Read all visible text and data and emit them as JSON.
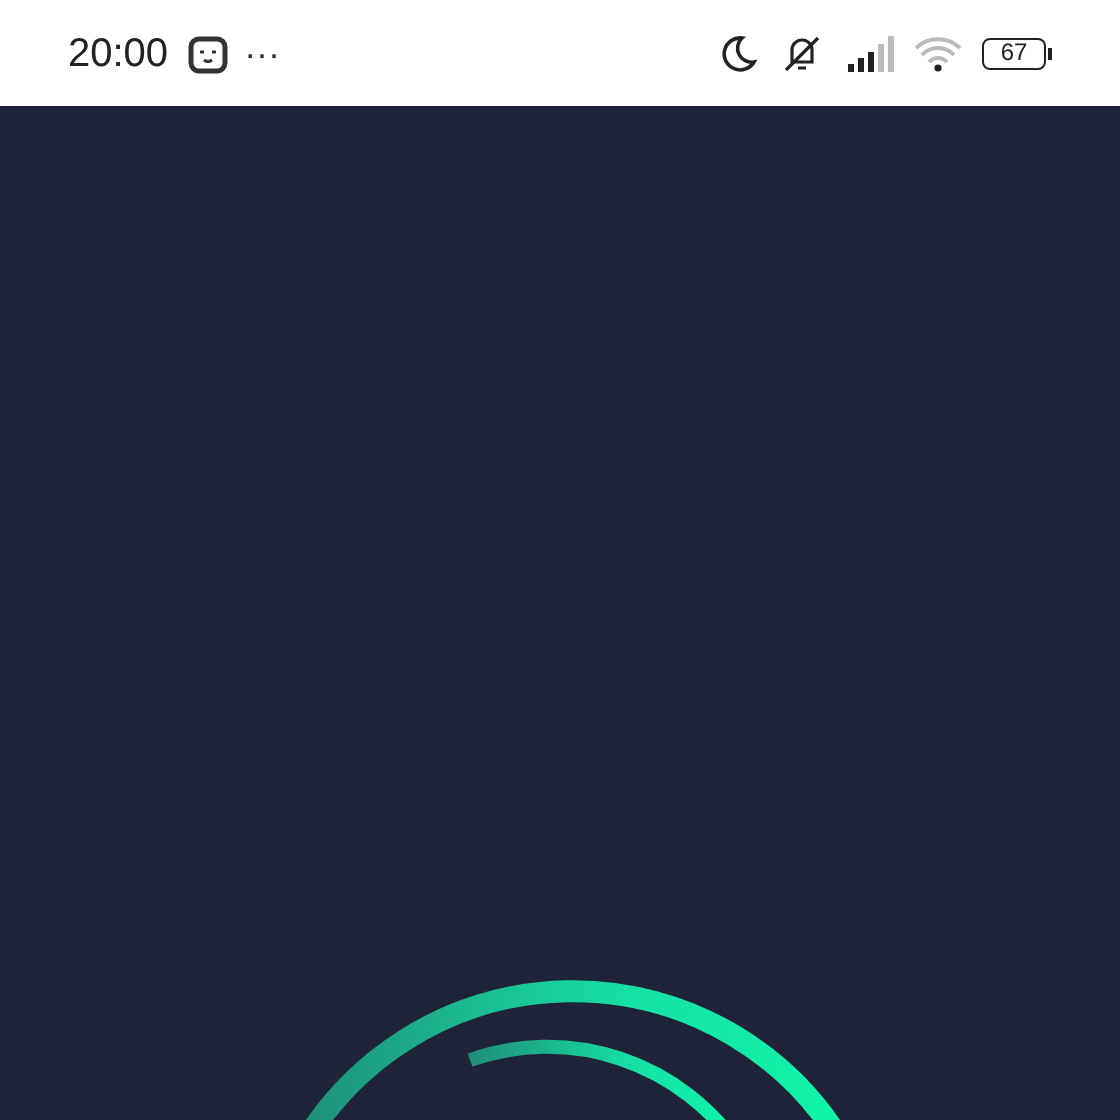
{
  "status_bar": {
    "time": "20:00",
    "more": "···",
    "battery": "67"
  },
  "splash": {
    "kind": "logo"
  }
}
